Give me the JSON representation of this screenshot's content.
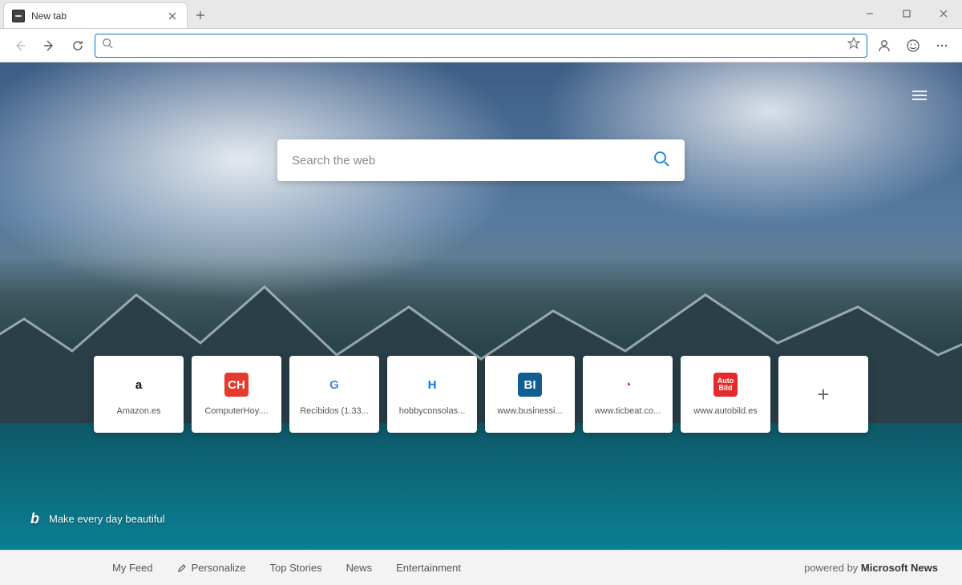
{
  "window": {
    "tab_title": "New tab"
  },
  "omnibox": {
    "value": "",
    "placeholder": ""
  },
  "hero": {
    "placeholder": "Search the web"
  },
  "tiles": [
    {
      "label": "Amazon.es",
      "icon_text": "a",
      "icon_bg": "#ffffff",
      "icon_fg": "#111111",
      "icon_name": "amazon-icon"
    },
    {
      "label": "ComputerHoy....",
      "icon_text": "CH",
      "icon_bg": "#e63a2e",
      "icon_fg": "#ffffff",
      "icon_name": "computerhoy-icon"
    },
    {
      "label": "Recibidos (1.33...",
      "icon_text": "G",
      "icon_bg": "#ffffff",
      "icon_fg": "#4285f4",
      "icon_name": "google-icon"
    },
    {
      "label": "hobbyconsolas...",
      "icon_text": "H",
      "icon_bg": "#ffffff",
      "icon_fg": "#0b74ff",
      "icon_name": "hobbyconsolas-icon"
    },
    {
      "label": "www.businessi...",
      "icon_text": "BI",
      "icon_bg": "#115e94",
      "icon_fg": "#ffffff",
      "icon_name": "businessinsider-icon"
    },
    {
      "label": "www.ticbeat.co...",
      "icon_text": "◔",
      "icon_bg": "#ffffff",
      "icon_fg": "#e42b2b",
      "icon_name": "ticbeat-icon"
    },
    {
      "label": "www.autobild.es",
      "icon_text": "Auto\nBild",
      "icon_bg": "#e42b2b",
      "icon_fg": "#ffffff",
      "icon_name": "autobild-icon"
    }
  ],
  "tagline": {
    "text": "Make every day beautiful"
  },
  "footer": {
    "items": [
      "My Feed",
      "Personalize",
      "Top Stories",
      "News",
      "Entertainment"
    ],
    "powered_prefix": "powered by ",
    "powered_brand": "Microsoft News"
  }
}
